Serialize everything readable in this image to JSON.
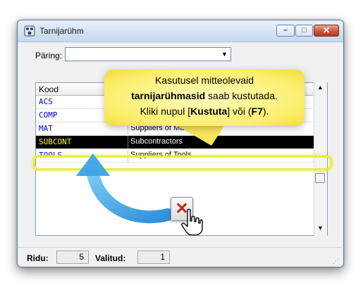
{
  "window": {
    "title": "Tarnijarühm"
  },
  "query": {
    "label": "Päring:",
    "value": ""
  },
  "grid": {
    "column_header": "Kood",
    "rows": [
      {
        "code": "ACS",
        "name": ""
      },
      {
        "code": "COMP",
        "name": ""
      },
      {
        "code": "MAT",
        "name": "Suppliers of Materials"
      },
      {
        "code": "SUBCONT",
        "name": "Subcontractors",
        "selected": true
      },
      {
        "code": "TOOLS",
        "name": "Suppliers of Tools"
      }
    ]
  },
  "callout": {
    "line1": "Kasutusel mitteolevaid",
    "line2_bold": "tarnijarühmasid",
    "line2_rest": " saab kustutada.",
    "line3_pre": "Kliki nupul [",
    "line3_bold1": "Kustuta",
    "line3_mid": "] või (",
    "line3_bold2": "F7",
    "line3_post": ")."
  },
  "status": {
    "rows_label": "Ridu:",
    "rows_value": "5",
    "selected_label": "Valitud:",
    "selected_value": "1"
  },
  "icons": [
    "app-icon",
    "minimize-icon",
    "maximize-icon",
    "close-icon",
    "dropdown-arrow-icon",
    "scroll-up-icon",
    "scroll-down-icon",
    "delete-icon",
    "hand-cursor-icon",
    "resize-grip-icon"
  ],
  "colors": {
    "code_text": "#0000dd",
    "selected_row_bg": "#000000",
    "selected_code_text": "#ffff00",
    "highlight": "#e8ef38",
    "callout_bg": "#fbee6e",
    "arrow": "#2f9ae0",
    "delete_x": "#c0281e"
  }
}
